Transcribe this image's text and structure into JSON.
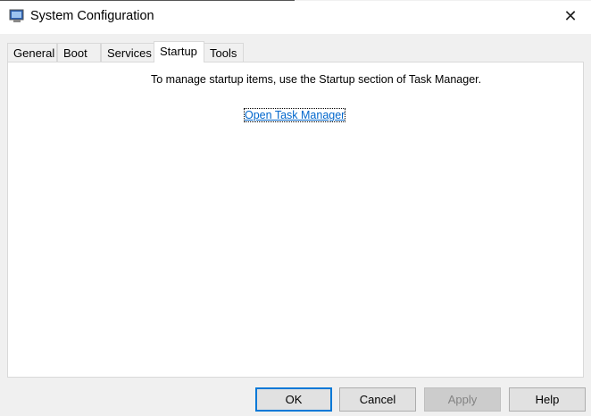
{
  "window": {
    "title": "System Configuration",
    "close_label": "✕",
    "icon": "msconfig-icon"
  },
  "tabs": [
    {
      "label": "General"
    },
    {
      "label": "Boot"
    },
    {
      "label": "Services"
    },
    {
      "label": "Startup",
      "active": true
    },
    {
      "label": "Tools"
    }
  ],
  "startup": {
    "message": "To manage startup items, use the Startup section of Task Manager.",
    "link": "Open Task Manager"
  },
  "buttons": {
    "ok": "OK",
    "cancel": "Cancel",
    "apply": "Apply",
    "help": "Help"
  },
  "colors": {
    "link": "#0066cc",
    "default_button_border": "#0078d7"
  }
}
